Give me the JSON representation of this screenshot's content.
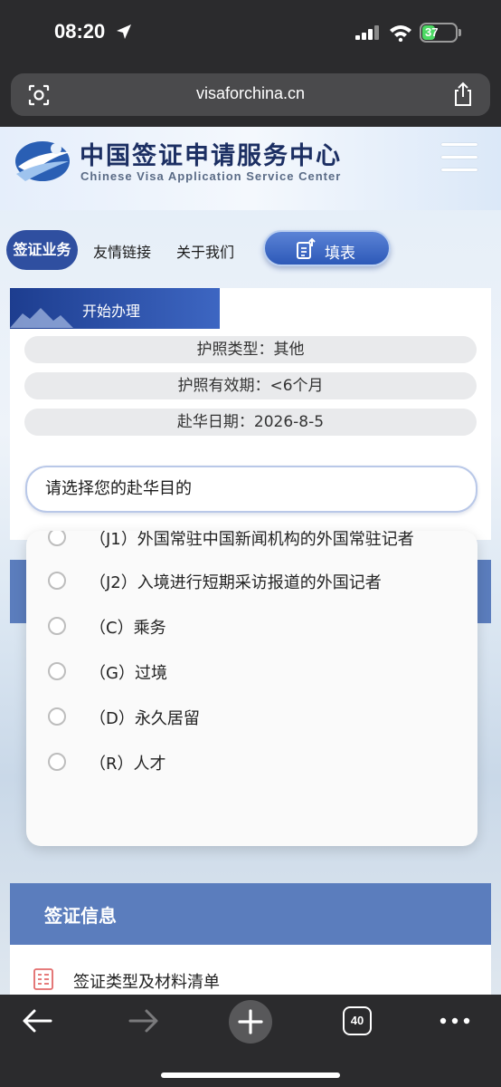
{
  "status_bar": {
    "time": "08:20",
    "battery": "37",
    "battery_level": 0.37
  },
  "browser": {
    "url": "visaforchina.cn",
    "tab_count": "40"
  },
  "site": {
    "title_cn": "中国签证申请服务中心",
    "title_en": "Chinese Visa Application Service Center"
  },
  "nav": {
    "items": [
      "签证业务",
      "友情链接",
      "关于我们"
    ],
    "fill_button": "填表"
  },
  "form": {
    "tab_label": "开始办理",
    "passport_type": "护照类型：其他",
    "passport_validity": "护照有效期：<6个月",
    "arrival_date": "赴华日期：2026-8-5",
    "purpose_select": "请选择您的赴华目的"
  },
  "purpose_options": [
    "（J1）外国常驻中国新闻机构的外国常驻记者",
    "（J2）入境进行短期采访报道的外国记者",
    "（C）乘务",
    "（G）过境",
    "（D）永久居留",
    "（R）人才"
  ],
  "visa_info": {
    "header": "签证信息",
    "items": [
      "签证类型及材料清单"
    ]
  },
  "colors": {
    "primary": "#2f4fa0",
    "band": "#5b7dbd",
    "dark": "#2b2b2d"
  }
}
